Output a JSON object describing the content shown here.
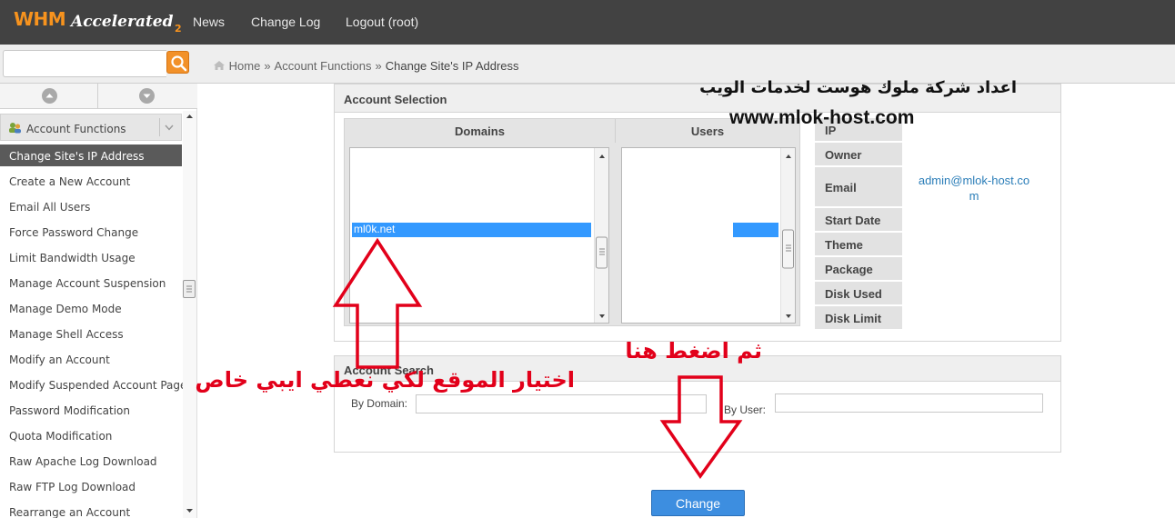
{
  "topbar": {
    "logo_main": "WHM",
    "logo_accent": "Accelerated",
    "logo_version": "2",
    "nav": [
      "News",
      "Change Log",
      "Logout (root)"
    ]
  },
  "search": {
    "placeholder": "",
    "value": ""
  },
  "breadcrumb": {
    "home": "Home",
    "section": "Account Functions",
    "current": "Change Site's IP Address",
    "separator": "»"
  },
  "sidebar": {
    "category": "Account Functions",
    "items": [
      {
        "label": "Change Site's IP Address",
        "active": true
      },
      {
        "label": "Create a New Account"
      },
      {
        "label": "Email All Users"
      },
      {
        "label": "Force Password Change"
      },
      {
        "label": "Limit Bandwidth Usage"
      },
      {
        "label": "Manage Account Suspension"
      },
      {
        "label": "Manage Demo Mode"
      },
      {
        "label": "Manage Shell Access"
      },
      {
        "label": "Modify an Account"
      },
      {
        "label": "Modify Suspended Account Page"
      },
      {
        "label": "Password Modification"
      },
      {
        "label": "Quota Modification"
      },
      {
        "label": "Raw Apache Log Download"
      },
      {
        "label": "Raw FTP Log Download"
      },
      {
        "label": "Rearrange an Account"
      }
    ]
  },
  "account_selection": {
    "title": "Account Selection",
    "domains_header": "Domains",
    "users_header": "Users",
    "selected_domain": "ml0k.net",
    "info_labels": [
      "IP",
      "Owner",
      "Email",
      "Start Date",
      "Theme",
      "Package",
      "Disk Used",
      "Disk Limit"
    ],
    "email_value": "admin@mlok-host.com"
  },
  "account_search": {
    "title": "Account Search",
    "by_domain_label": "By Domain:",
    "by_user_label": "By User:",
    "domain_value": "",
    "user_value": ""
  },
  "change_button": "Change",
  "annotations": {
    "heading_ar": "اعداد شركة ملوك هوست لخدمات الويب",
    "website": "www.mlok-host.com",
    "select_ar": "اختيار الموقع لكي نعطي ايبي خاص",
    "press_ar": "ثم اضغط هنا",
    "color_red": "#e2001a",
    "color_black": "#111111"
  },
  "colors": {
    "topbar": "#424242",
    "accent_orange": "#f7931e",
    "selection_blue": "#3399ff",
    "button_blue": "#3d8ee0"
  }
}
